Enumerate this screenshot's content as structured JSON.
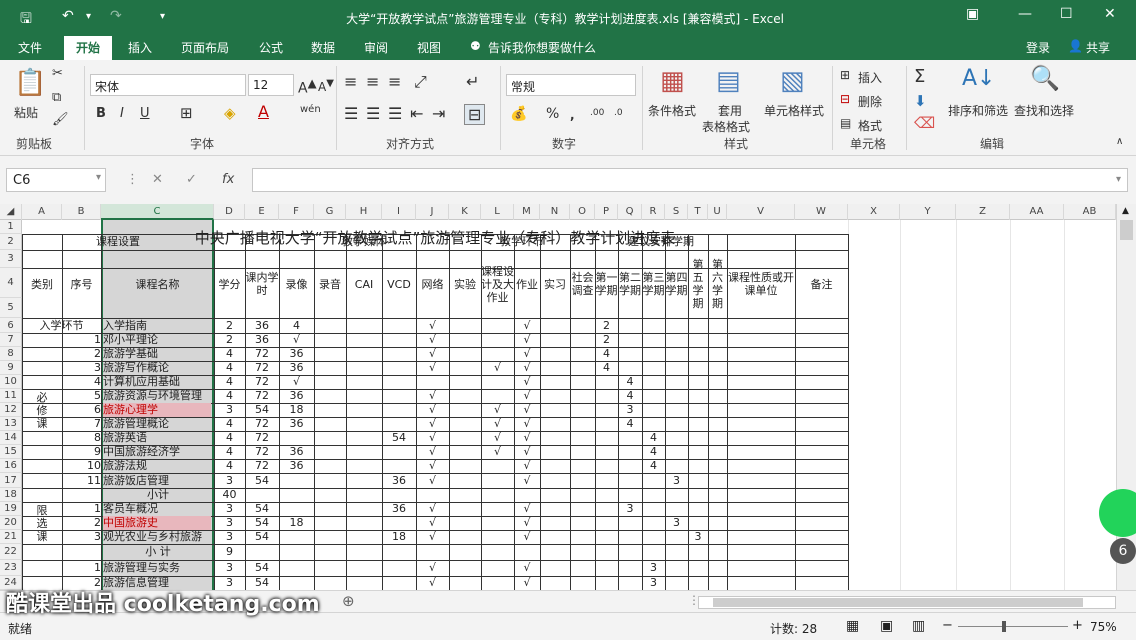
{
  "window": {
    "title": "大学“开放教学试点”旅游管理专业（专科）教学计划进度表.xls  [兼容模式] - Excel"
  },
  "tabs": [
    "文件",
    "开始",
    "插入",
    "页面布局",
    "公式",
    "数据",
    "审阅",
    "视图"
  ],
  "tell_me": "告诉我你想要做什么",
  "account": {
    "login": "登录",
    "share": "共享"
  },
  "ribbon": {
    "paste": "粘贴",
    "clipboard": "剪贴板",
    "font_name": "宋体",
    "font_size": "12",
    "font_group": "字体",
    "align_group": "对齐方式",
    "number_format": "常规",
    "number_group": "数字",
    "cond_format": "条件格式",
    "table_format_1": "套用",
    "table_format_2": "表格格式",
    "cell_style": "单元格样式",
    "styles_group": "样式",
    "insert": "插入",
    "delete": "删除",
    "format": "格式",
    "cells_group": "单元格",
    "sort_filter": "排序和筛选",
    "find_select": "查找和选择",
    "edit_group": "编辑",
    "wen": "wén"
  },
  "formula_bar": {
    "name_box": "C6",
    "fx": "fx"
  },
  "columns": [
    "A",
    "B",
    "C",
    "D",
    "E",
    "F",
    "G",
    "H",
    "I",
    "J",
    "K",
    "L",
    "M",
    "N",
    "O",
    "P",
    "Q",
    "R",
    "S",
    "T",
    "U",
    "V",
    "W",
    "X",
    "Y",
    "Z",
    "AA",
    "AB"
  ],
  "rows": [
    "1",
    "2",
    "3",
    "4",
    "5",
    "6",
    "7",
    "8",
    "9",
    "10",
    "11",
    "12",
    "13",
    "14",
    "15",
    "16",
    "17",
    "18",
    "19",
    "20",
    "21",
    "22",
    "23",
    "24"
  ],
  "sheet": {
    "title": "中央广播电视大学“开放教学试点”旅游管理专业（专科）教学计划进度表",
    "hdr_course": "课程设置",
    "hdr_media": "教学媒体",
    "hdr_links": "教学环节",
    "hdr_sched": "建议安排学期",
    "hdr_type": "类别",
    "hdr_no": "序号",
    "hdr_name": "课程名称",
    "hdr_credit": "学分",
    "hdr_hours": "课内学时",
    "hdr_video": "录像",
    "hdr_audio": "录音",
    "hdr_cai": "CAI",
    "hdr_vcd": "VCD",
    "hdr_net": "网络",
    "hdr_exp": "实验",
    "hdr_design": "课程设计及大作业",
    "hdr_hw": "作业",
    "hdr_practice": "实习",
    "hdr_survey": "社会调查",
    "hdr_t1": "第一学期",
    "hdr_t2": "第二学期",
    "hdr_t3": "第三学期",
    "hdr_t4": "第四学期",
    "hdr_t5": "第五学期",
    "hdr_t6": "第六学期",
    "hdr_nature": "课程性质或开课单位",
    "hdr_note": "备注",
    "cat_intro": "入学环节",
    "cat_required": "必修课",
    "cat_limited": "限选课",
    "subtotal": "小计",
    "subtotal2": "小  计",
    "courses": [
      {
        "no": "",
        "name": "入学指南",
        "credit": "2",
        "hours": "36",
        "video": "4",
        "vcd": "",
        "net": "√",
        "design": "",
        "hw": "√",
        "term": "2",
        "tcol": "P"
      },
      {
        "no": "1",
        "name": "邓小平理论",
        "credit": "2",
        "hours": "36",
        "video": "√",
        "vcd": "",
        "net": "√",
        "design": "",
        "hw": "√",
        "term": "2",
        "tcol": "P"
      },
      {
        "no": "2",
        "name": "旅游学基础",
        "credit": "4",
        "hours": "72",
        "video": "36",
        "vcd": "",
        "net": "√",
        "design": "",
        "hw": "√",
        "term": "4",
        "tcol": "P"
      },
      {
        "no": "3",
        "name": "旅游写作概论",
        "credit": "4",
        "hours": "72",
        "video": "36",
        "vcd": "",
        "net": "√",
        "design": "√",
        "hw": "√",
        "term": "4",
        "tcol": "P"
      },
      {
        "no": "4",
        "name": "计算机应用基础",
        "credit": "4",
        "hours": "72",
        "video": "√",
        "vcd": "",
        "net": "",
        "design": "",
        "hw": "√",
        "term": "4",
        "tcol": "Q"
      },
      {
        "no": "5",
        "name": "旅游资源与环境管理",
        "credit": "4",
        "hours": "72",
        "video": "36",
        "vcd": "",
        "net": "√",
        "design": "",
        "hw": "√",
        "term": "4",
        "tcol": "Q"
      },
      {
        "no": "6",
        "name": "旅游心理学",
        "credit": "3",
        "hours": "54",
        "video": "18",
        "vcd": "",
        "net": "√",
        "design": "√",
        "hw": "√",
        "term": "3",
        "tcol": "Q"
      },
      {
        "no": "7",
        "name": "旅游管理概论",
        "credit": "4",
        "hours": "72",
        "video": "36",
        "vcd": "",
        "net": "√",
        "design": "√",
        "hw": "√",
        "term": "4",
        "tcol": "Q"
      },
      {
        "no": "8",
        "name": "旅游英语",
        "credit": "4",
        "hours": "72",
        "video": "",
        "vcd": "54",
        "net": "√",
        "design": "√",
        "hw": "√",
        "term": "4",
        "tcol": "R"
      },
      {
        "no": "9",
        "name": "中国旅游经济学",
        "credit": "4",
        "hours": "72",
        "video": "36",
        "vcd": "",
        "net": "√",
        "design": "√",
        "hw": "√",
        "term": "4",
        "tcol": "R"
      },
      {
        "no": "10",
        "name": "旅游法规",
        "credit": "4",
        "hours": "72",
        "video": "36",
        "vcd": "",
        "net": "√",
        "design": "",
        "hw": "√",
        "term": "4",
        "tcol": "R"
      },
      {
        "no": "11",
        "name": "旅游饭店管理",
        "credit": "3",
        "hours": "54",
        "video": "",
        "vcd": "36",
        "net": "√",
        "design": "",
        "hw": "√",
        "term": "3",
        "tcol": "S"
      },
      {
        "no": "",
        "name": "小计",
        "credit": "40",
        "hours": "",
        "video": "",
        "vcd": "",
        "net": "",
        "design": "",
        "hw": "",
        "term": "",
        "tcol": ""
      },
      {
        "no": "1",
        "name": "客员车概况",
        "credit": "3",
        "hours": "54",
        "video": "",
        "vcd": "36",
        "net": "√",
        "design": "",
        "hw": "√",
        "term": "3",
        "tcol": "Q"
      },
      {
        "no": "2",
        "name": "中国旅游史",
        "credit": "3",
        "hours": "54",
        "video": "18",
        "vcd": "",
        "net": "√",
        "design": "",
        "hw": "√",
        "term": "3",
        "tcol": "S"
      },
      {
        "no": "3",
        "name": "观光农业与乡村旅游",
        "credit": "3",
        "hours": "54",
        "video": "",
        "vcd": "18",
        "net": "√",
        "design": "",
        "hw": "√",
        "term": "3",
        "tcol": "T"
      },
      {
        "no": "",
        "name": "小  计",
        "credit": "9",
        "hours": "",
        "video": "",
        "vcd": "",
        "net": "",
        "design": "",
        "hw": "",
        "term": "",
        "tcol": ""
      },
      {
        "no": "1",
        "name": "旅游管理与实务",
        "credit": "3",
        "hours": "54",
        "video": "",
        "vcd": "",
        "net": "√",
        "design": "",
        "hw": "√",
        "term": "3",
        "tcol": "R"
      },
      {
        "no": "2",
        "name": "旅游信息管理",
        "credit": "3",
        "hours": "54",
        "video": "",
        "vcd": "",
        "net": "√",
        "design": "",
        "hw": "√",
        "term": "3",
        "tcol": "R"
      }
    ]
  },
  "status": {
    "ready": "就绪",
    "count": "计数: 28",
    "zoom": "75%"
  },
  "overlay": {
    "badge": "6",
    "watermark": "酷课堂出品 coolketang.com"
  }
}
